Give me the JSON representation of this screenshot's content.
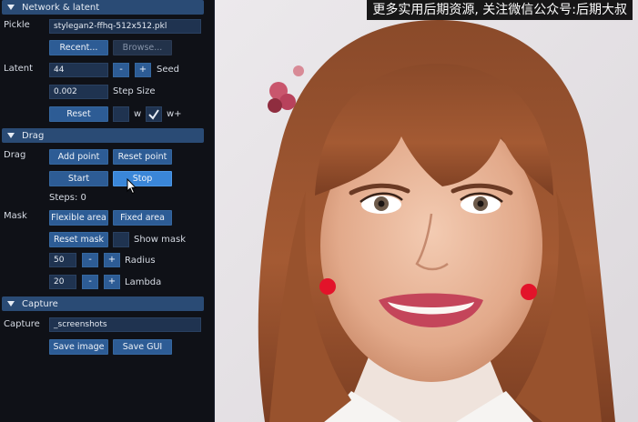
{
  "sections": {
    "network": "Network & latent",
    "drag": "Drag",
    "capture": "Capture"
  },
  "network": {
    "pickle_label": "Pickle",
    "pickle_value": "stylegan2-ffhq-512x512.pkl",
    "recent_button": "Recent...",
    "browse_button": "Browse...",
    "latent_label": "Latent",
    "latent_value": "44",
    "minus": "-",
    "plus": "+",
    "seed_label": "Seed",
    "step_value": "0.002",
    "step_label": "Step Size",
    "reset_button": "Reset",
    "w_label": "w",
    "wplus_label": "w+"
  },
  "drag": {
    "drag_label": "Drag",
    "add_point_button": "Add point",
    "reset_point_button": "Reset point",
    "start_button": "Start",
    "stop_button": "Stop",
    "steps_text": "Steps: 0",
    "mask_label": "Mask",
    "flexible_area_button": "Flexible area",
    "fixed_area_button": "Fixed area",
    "reset_mask_button": "Reset mask",
    "show_mask_label": "Show mask",
    "radius_value": "50",
    "radius_label": "Radius",
    "lambda_value": "20",
    "lambda_label": "Lambda"
  },
  "capture": {
    "capture_label": "Capture",
    "capture_path": "_screenshots",
    "save_image_button": "Save image",
    "save_gui_button": "Save GUI"
  },
  "banner_text": "更多实用后期资源, 关注微信公众号:后期大叔",
  "colors": {
    "header": "#2a4b75",
    "button": "#2d5c95",
    "button_active": "#3a86d8",
    "field": "#1f3350",
    "drag_point": "#e3132a"
  }
}
